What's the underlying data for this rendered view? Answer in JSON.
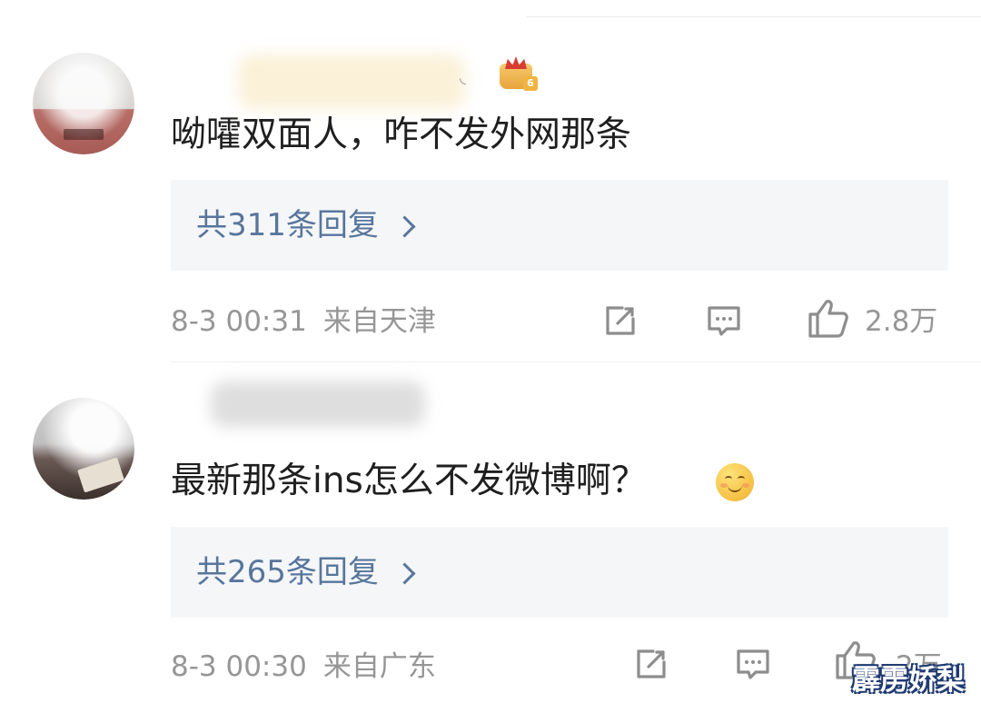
{
  "comments": [
    {
      "text": "呦嚯双面人，咋不发外网那条",
      "replies": "共311条回复",
      "date": "8-3 00:31",
      "location": "来自天津",
      "likes": "2.8万",
      "badge_level": "6"
    },
    {
      "text": "最新那条ins怎么不发微博啊？",
      "replies": "共265条回复",
      "date": "8-3 00:30",
      "location": "来自广东",
      "likes": "2万"
    }
  ],
  "watermark": "霹雳娇梨",
  "colors": {
    "reply_link": "#58769c",
    "meta_text": "#969696",
    "reply_bg": "#f5f6f8",
    "badge_gold": "#f2b441"
  },
  "icons": [
    "share-icon",
    "comment-icon",
    "like-icon",
    "smile-emoji-icon",
    "crown-badge-icon"
  ]
}
